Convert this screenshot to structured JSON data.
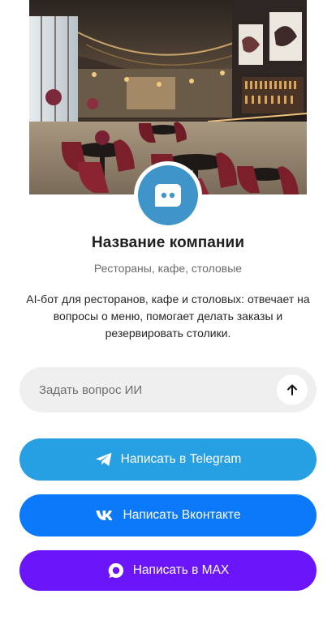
{
  "hero": {
    "image": "restaurant-interior-photo"
  },
  "profile": {
    "avatar_icon": "chat-bot-icon",
    "company_name": "Название компании",
    "category": "Рестораны, кафе, столовые",
    "description": "AI-бот для ресторанов, кафе и столовых: отвечает на вопросы о меню, помогает делать заказы и резервировать столики."
  },
  "ask": {
    "placeholder": "Задать вопрос ИИ",
    "value": "",
    "send_icon": "arrow-up-icon"
  },
  "actions": {
    "telegram": {
      "label": "Написать в Telegram",
      "icon": "telegram-icon",
      "color": "#27a0e3"
    },
    "vk": {
      "label": "Написать Вконтакте",
      "icon": "vk-icon",
      "color": "#0c79fb"
    },
    "max": {
      "label": "Написать в MAX",
      "icon": "max-icon",
      "color": "#6b15fb"
    }
  },
  "colors": {
    "avatar": "#3f95c9",
    "input_bg": "#efefef"
  }
}
